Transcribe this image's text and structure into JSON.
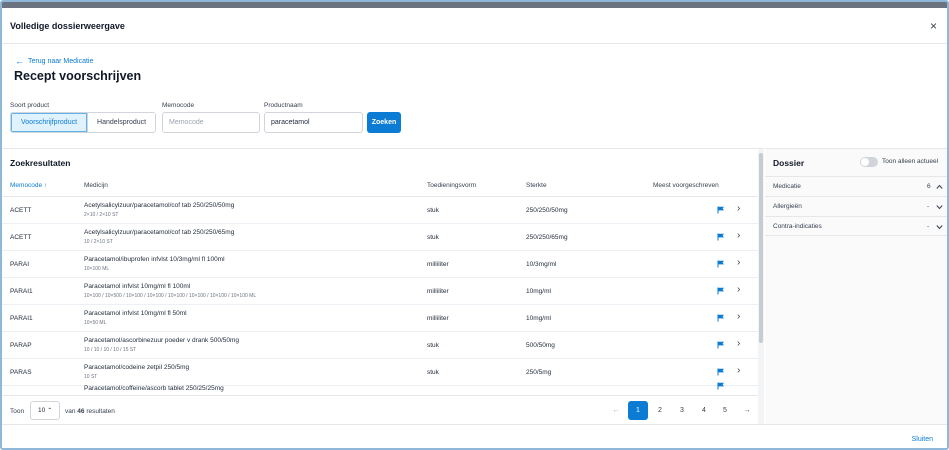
{
  "modal": {
    "title": "Volledige dossierweergave",
    "close_glyph": "×",
    "close_label": "Sluiten"
  },
  "back": {
    "arrow": "←",
    "label": "Terug naar Medicatie"
  },
  "page_title": "Recept voorschrijven",
  "search": {
    "product_type_label": "Soort product",
    "product_type_options": [
      "Voorschrijfproduct",
      "Handelsproduct"
    ],
    "product_type_selected": "Voorschrijfproduct",
    "memocode_label": "Memocode",
    "memocode_placeholder": "Memocode",
    "memocode_value": "",
    "productname_label": "Productnaam",
    "productname_value": "paracetamol",
    "search_button": "Zoeken"
  },
  "results": {
    "title": "Zoekresultaten",
    "columns": {
      "memocode": "Memocode",
      "sort_glyph": "↑",
      "medicijn": "Medicijn",
      "toedieningsvorm": "Toedieningsvorm",
      "sterkte": "Sterkte",
      "meest": "Meest voorgeschreven"
    },
    "rows": [
      {
        "memocode": "ACETT",
        "medicijn": "Acetylsalicylzuur/paracetamol/cof tab 250/250/50mg",
        "sub": "2×10 / 2×10 ST",
        "toediening": "stuk",
        "sterkte": "250/250/50mg"
      },
      {
        "memocode": "ACETT",
        "medicijn": "Acetylsalicylzuur/paracetamol/cof tab 250/250/65mg",
        "sub": "10 / 2×10 ST",
        "toediening": "stuk",
        "sterkte": "250/250/65mg"
      },
      {
        "memocode": "PARAI",
        "medicijn": "Paracetamol/ibuprofen infvlst 10/3mg/ml fl 100ml",
        "sub": "10×100 ML",
        "toediening": "milliliter",
        "sterkte": "10/3mg/ml"
      },
      {
        "memocode": "PARAI1",
        "medicijn": "Paracetamol infvlst 10mg/ml fl 100ml",
        "sub": "10×100 / 10×500 / 10×100 / 10×100 / 10×100 / 10×100 / 10×100 / 10×100 ML",
        "toediening": "milliliter",
        "sterkte": "10mg/ml"
      },
      {
        "memocode": "PARAI1",
        "medicijn": "Paracetamol infvlst 10mg/ml fl 50ml",
        "sub": "10×50 ML",
        "toediening": "milliliter",
        "sterkte": "10mg/ml"
      },
      {
        "memocode": "PARAP",
        "medicijn": "Paracetamol/ascorbinezuur poeder v drank 500/50mg",
        "sub": "10 / 10 / 10 / 10 / 15 ST",
        "toediening": "stuk",
        "sterkte": "500/50mg"
      },
      {
        "memocode": "PARAS",
        "medicijn": "Paracetamol/codeine zetpil 250/5mg",
        "sub": "10 ST",
        "toediening": "stuk",
        "sterkte": "250/5mg"
      },
      {
        "memocode": "",
        "medicijn": "Paracetamol/coffeine/ascorb tablet 250/25/25mg",
        "sub": "",
        "toediening": "",
        "sterkte": ""
      }
    ],
    "chevron": "›",
    "footer": {
      "toon_label": "Toon",
      "page_size": "10",
      "page_size_glyph": "⌃",
      "count_prefix": "van",
      "count": "46",
      "count_suffix": "resultaten",
      "prev": "←",
      "pages": [
        "1",
        "2",
        "3",
        "4",
        "5"
      ],
      "current_page": "1",
      "next": "→"
    }
  },
  "dossier": {
    "title": "Dossier",
    "toggle_label": "Toon alleen actueel",
    "toggle_on": false,
    "sections": [
      {
        "label": "Medicatie",
        "count": "6",
        "chevron": "^"
      },
      {
        "label": "Allergieën",
        "count": "-",
        "chevron": "v"
      },
      {
        "label": "Contra-indicaties",
        "count": "-",
        "chevron": "v"
      }
    ]
  },
  "colors": {
    "accent": "#0b7bd3",
    "accent_light": "#e0f2fe",
    "border": "#e5e7eb",
    "frame": "#8fb8d8"
  }
}
